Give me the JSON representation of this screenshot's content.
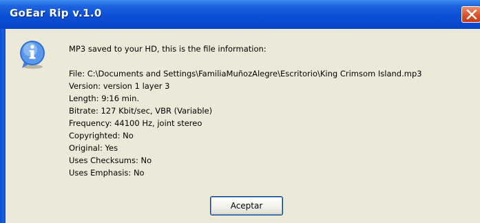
{
  "window": {
    "title": "GoEar Rip v.1.0"
  },
  "icons": {
    "info": "information-icon",
    "close": "close-icon"
  },
  "message": {
    "header": "MP3 saved to your HD, this is the file information:",
    "lines": [
      "File: C:\\Documents and Settings\\FamiliaMuñozAlegre\\Escritorio\\King Crimsom Island.mp3",
      "Version: version 1 layer 3",
      "Length: 9:16 min.",
      "Bitrate: 127 Kbit/sec, VBR (Variable)",
      "Frequency: 44100 Hz, joint stereo",
      "Copyrighted: No",
      "Original: Yes",
      "Uses Checksums: No",
      "Uses Emphasis: No"
    ]
  },
  "buttons": {
    "ok_label": "Aceptar"
  },
  "colors": {
    "titlebar": "#0b4fd6",
    "dialog_bg": "#ece9d8",
    "close_button": "#d7532e"
  }
}
